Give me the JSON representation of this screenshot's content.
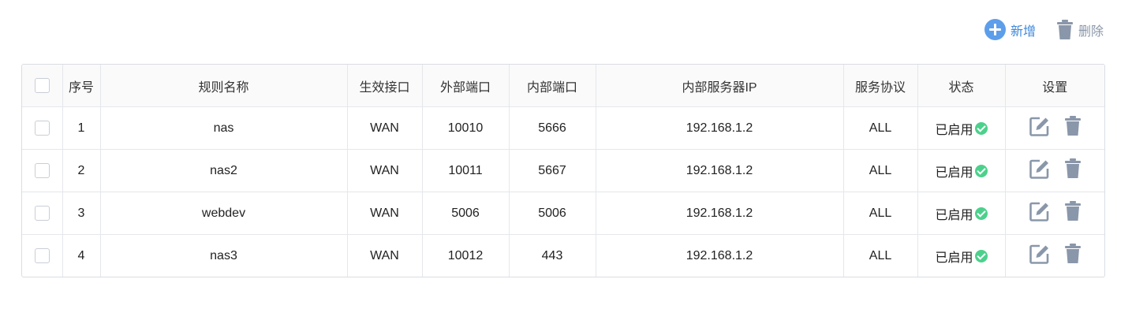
{
  "toolbar": {
    "add_label": "新增",
    "delete_label": "删除"
  },
  "colors": {
    "accent": "#3d87d9",
    "icon_gray": "#8a97aa",
    "status_ok": "#4cd18c"
  },
  "table": {
    "headers": [
      "序号",
      "规则名称",
      "生效接口",
      "外部端口",
      "内部端口",
      "内部服务器IP",
      "服务协议",
      "状态",
      "设置"
    ],
    "rows": [
      {
        "index": "1",
        "name": "nas",
        "interface": "WAN",
        "external_port": "10010",
        "internal_port": "5666",
        "server_ip": "192.168.1.2",
        "protocol": "ALL",
        "status": "已启用"
      },
      {
        "index": "2",
        "name": "nas2",
        "interface": "WAN",
        "external_port": "10011",
        "internal_port": "5667",
        "server_ip": "192.168.1.2",
        "protocol": "ALL",
        "status": "已启用"
      },
      {
        "index": "3",
        "name": "webdev",
        "interface": "WAN",
        "external_port": "5006",
        "internal_port": "5006",
        "server_ip": "192.168.1.2",
        "protocol": "ALL",
        "status": "已启用"
      },
      {
        "index": "4",
        "name": "nas3",
        "interface": "WAN",
        "external_port": "10012",
        "internal_port": "443",
        "server_ip": "192.168.1.2",
        "protocol": "ALL",
        "status": "已启用"
      }
    ]
  }
}
